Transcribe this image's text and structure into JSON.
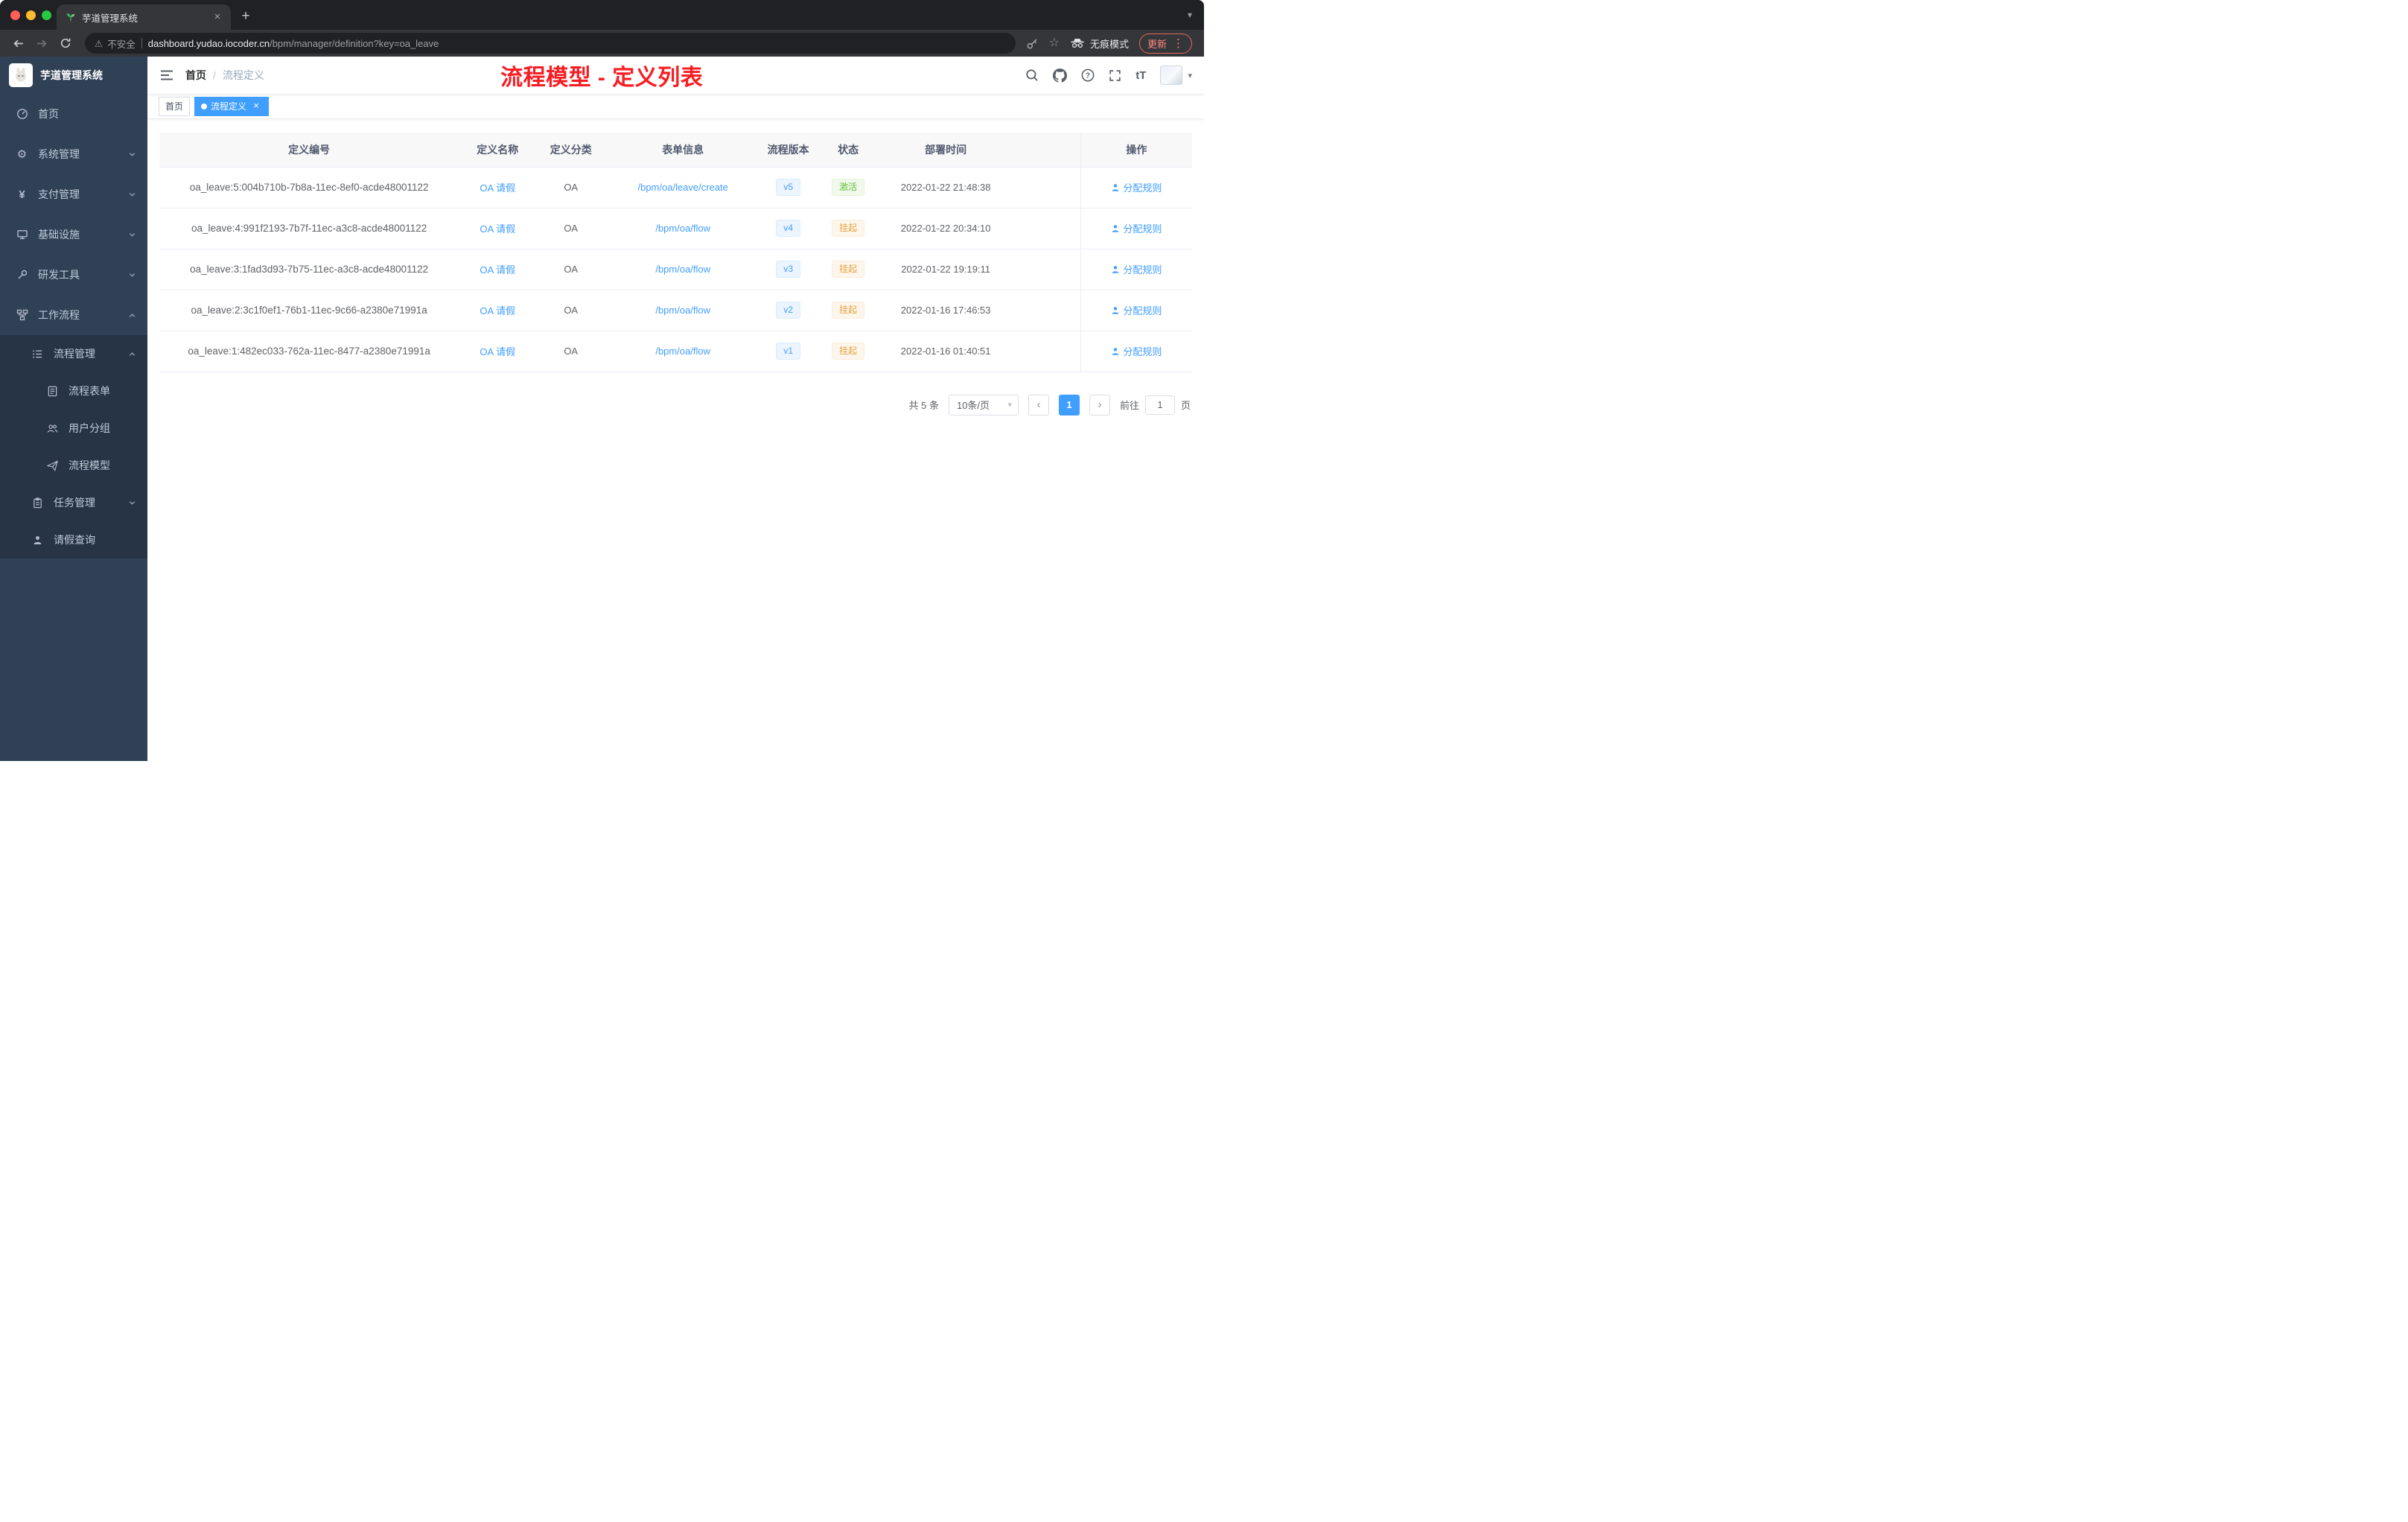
{
  "browser": {
    "tab_title": "芋道管理系统",
    "security_label": "不安全",
    "url_host": "dashboard.yudao.iocoder.cn",
    "url_path": "/bpm/manager/definition?key=oa_leave",
    "incognito_label": "无痕模式",
    "update_label": "更新"
  },
  "glyphs": {
    "close": "×",
    "plus": "+",
    "kebab": "⋮",
    "caret": "▾",
    "warning": "⚠",
    "star": "☆",
    "gear": "⚙",
    "yen": "¥",
    "question": "?",
    "text_size": "tT",
    "breadcrumb_sep": "/",
    "prev": "‹",
    "next": "›"
  },
  "sidebar": {
    "app_title": "芋道管理系统",
    "items": [
      {
        "label": "首页"
      },
      {
        "label": "系统管理"
      },
      {
        "label": "支付管理"
      },
      {
        "label": "基础设施"
      },
      {
        "label": "研发工具"
      },
      {
        "label": "工作流程"
      },
      {
        "label": "流程管理"
      },
      {
        "label": "流程表单"
      },
      {
        "label": "用户分组"
      },
      {
        "label": "流程模型"
      },
      {
        "label": "任务管理"
      },
      {
        "label": "请假查询"
      }
    ]
  },
  "header": {
    "breadcrumb_home": "首页",
    "breadcrumb_current": "流程定义",
    "annotation": "流程模型 - 定义列表"
  },
  "tags": {
    "home": "首页",
    "active": "流程定义"
  },
  "table": {
    "columns": [
      "定义编号",
      "定义名称",
      "定义分类",
      "表单信息",
      "流程版本",
      "状态",
      "部署时间",
      "操作"
    ],
    "rows": [
      {
        "id": "oa_leave:5:004b710b-7b8a-11ec-8ef0-acde48001122",
        "name": "OA 请假",
        "category": "OA",
        "form": "/bpm/oa/leave/create",
        "version": "v5",
        "status": "激活",
        "status_type": "success",
        "time": "2022-01-22 21:48:38",
        "action": "分配规则"
      },
      {
        "id": "oa_leave:4:991f2193-7b7f-11ec-a3c8-acde48001122",
        "name": "OA 请假",
        "category": "OA",
        "form": "/bpm/oa/flow",
        "version": "v4",
        "status": "挂起",
        "status_type": "warning",
        "time": "2022-01-22 20:34:10",
        "action": "分配规则"
      },
      {
        "id": "oa_leave:3:1fad3d93-7b75-11ec-a3c8-acde48001122",
        "name": "OA 请假",
        "category": "OA",
        "form": "/bpm/oa/flow",
        "version": "v3",
        "status": "挂起",
        "status_type": "warning",
        "time": "2022-01-22 19:19:11",
        "action": "分配规则"
      },
      {
        "id": "oa_leave:2:3c1f0ef1-76b1-11ec-9c66-a2380e71991a",
        "name": "OA 请假",
        "category": "OA",
        "form": "/bpm/oa/flow",
        "version": "v2",
        "status": "挂起",
        "status_type": "warning",
        "time": "2022-01-16 17:46:53",
        "action": "分配规则"
      },
      {
        "id": "oa_leave:1:482ec033-762a-11ec-8477-a2380e71991a",
        "name": "OA 请假",
        "category": "OA",
        "form": "/bpm/oa/flow",
        "version": "v1",
        "status": "挂起",
        "status_type": "warning",
        "time": "2022-01-16 01:40:51",
        "action": "分配规则"
      }
    ]
  },
  "pagination": {
    "total": "共 5 条",
    "page_size": "10条/页",
    "current_page": "1",
    "goto_label": "前往",
    "goto_value": "1",
    "unit": "页"
  },
  "colors": {
    "accent": "#409eff",
    "success": "#67c23a",
    "warning": "#e6a23c",
    "annotation_red": "#f81d22",
    "sidebar_bg": "#304156",
    "submenu_bg": "#263445"
  }
}
